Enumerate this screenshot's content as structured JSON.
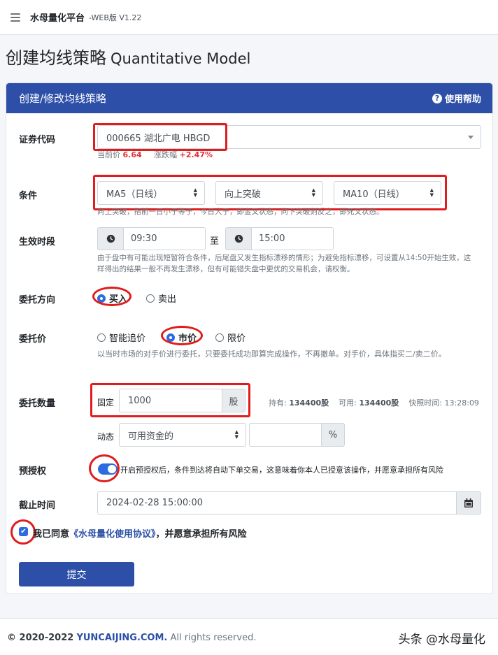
{
  "app": {
    "title": "水母量化平台",
    "version": "-WEB版 V1.22"
  },
  "page": {
    "title": "创建均线策略",
    "title_en": "Quantitative Model"
  },
  "card": {
    "header": "创建/修改均线策略",
    "help": "使用帮助"
  },
  "security": {
    "label": "证券代码",
    "value": "000665 湖北广电 HBGD",
    "price_label": "当前价",
    "price": "6.64",
    "change_label": "涨跌幅",
    "change": "+2.47%"
  },
  "condition": {
    "label": "条件",
    "ma_short": "MA5（日线）",
    "direction": "向上突破",
    "ma_long": "MA10（日线）",
    "hint": "向上突破，指前一日小于等于，今日大于，即金叉状态；向下突破则反之，即死叉状态。"
  },
  "period": {
    "label": "生效时段",
    "start": "09:30",
    "to": "至",
    "end": "15:00",
    "hint1": "由于盘中有可能出现短暂符合条件，后尾盘又发生指标漂移的情形；为避免指标漂移，可设置从14:50开始生效，这",
    "hint2": "样得出的结果一般不再发生漂移，但有可能错失盘中更优的交易机会，请权衡。"
  },
  "side": {
    "label": "委托方向",
    "buy": "买入",
    "sell": "卖出"
  },
  "price_type": {
    "label": "委托价",
    "smart": "智能追价",
    "market": "市价",
    "limit": "限价",
    "hint": "以当时市场的对手价进行委托，只要委托成功即算完成操作，不再撤单。对手价，具体指买二/卖二价。"
  },
  "quantity": {
    "label": "委托数量",
    "fixed": "固定",
    "value": "1000",
    "unit": "股",
    "holding_label": "持有:",
    "holding": "134400股",
    "available_label": "可用:",
    "available": "134400股",
    "snapshot_label": "快照时间:",
    "snapshot": "13:28:09",
    "dynamic": "动态",
    "dynamic_basis": "可用资金的",
    "percent_unit": "%"
  },
  "preauth": {
    "label": "预授权",
    "text": "开启预授权后，条件到达将自动下单交易，这意味着你本人已授意该操作，并愿意承担所有风险"
  },
  "deadline": {
    "label": "截止时间",
    "value": "2024-02-28 15:00:00"
  },
  "agreement": {
    "prefix": "我已同意",
    "link": "《水母量化使用协议》",
    "suffix": "，并愿意承担所有风险"
  },
  "submit": "提交",
  "footer": {
    "copyright": "© 2020-2022",
    "site": "YUNCAIJING.COM.",
    "rights": "All rights reserved."
  },
  "watermark": "头条 @水母量化",
  "colors": {
    "primary": "#2d4fa8",
    "accent": "#2d6be0",
    "annotation": "#e01c1c",
    "up": "#e0323c"
  }
}
